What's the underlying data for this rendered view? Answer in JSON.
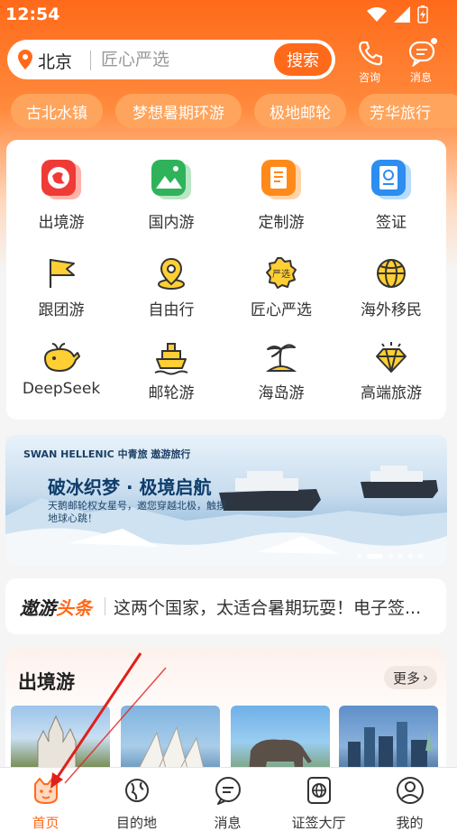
{
  "status_bar": {
    "time": "12:54"
  },
  "header": {
    "city": "北京",
    "search_placeholder": "匠心严选",
    "search_button": "搜索",
    "consult_label": "咨询",
    "message_label": "消息"
  },
  "hot_tags": [
    "古北水镇",
    "梦想暑期环游",
    "极地邮轮",
    "芳华旅行"
  ],
  "categories": [
    {
      "label": "出境游",
      "icon": "outbound-globe-icon"
    },
    {
      "label": "国内游",
      "icon": "domestic-mountain-icon"
    },
    {
      "label": "定制游",
      "icon": "custom-doc-icon"
    },
    {
      "label": "签证",
      "icon": "visa-passport-icon"
    },
    {
      "label": "跟团游",
      "icon": "flag-icon"
    },
    {
      "label": "自由行",
      "icon": "map-pin-icon"
    },
    {
      "label": "匠心严选",
      "icon": "quality-badge-icon"
    },
    {
      "label": "海外移民",
      "icon": "world-icon"
    },
    {
      "label": "DeepSeek",
      "icon": "whale-icon"
    },
    {
      "label": "邮轮游",
      "icon": "cruise-ship-icon"
    },
    {
      "label": "海岛游",
      "icon": "palm-island-icon"
    },
    {
      "label": "高端旅游",
      "icon": "diamond-icon"
    }
  ],
  "banner": {
    "brands": "SWAN HELLENIC  中青旅  遨游旅行",
    "title": "破冰织梦 · 极境启航",
    "subtitle": "天鹅邮轮权女星号，邀您穿越北极，触摸地球心跳！"
  },
  "news": {
    "brand_a": "遨游",
    "brand_b": "头条",
    "headline": "这两个国家，太适合暑期玩耍！电子签..."
  },
  "outbound_section": {
    "title": "出境游",
    "more": "更多"
  },
  "tabbar": [
    {
      "label": "首页",
      "icon": "home-face-icon"
    },
    {
      "label": "目的地",
      "icon": "planet-icon"
    },
    {
      "label": "消息",
      "icon": "chat-icon"
    },
    {
      "label": "证签大厅",
      "icon": "visa-hall-icon"
    },
    {
      "label": "我的",
      "icon": "profile-icon"
    }
  ],
  "colors": {
    "accent": "#ff6a1a"
  }
}
